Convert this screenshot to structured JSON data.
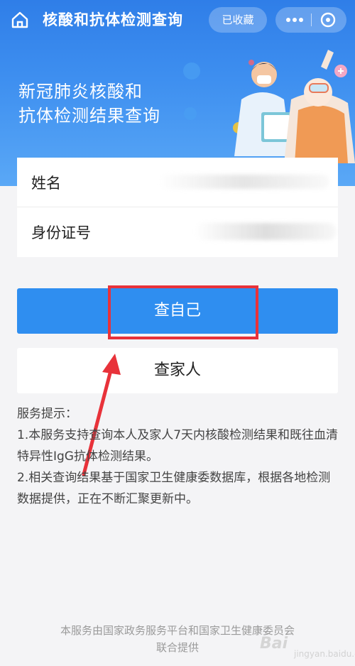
{
  "nav": {
    "title": "核酸和抗体检测查询",
    "collect_label": "已收藏",
    "icons": {
      "home": "home-icon",
      "more": "more-icon",
      "close": "close-circle-icon"
    }
  },
  "banner": {
    "title_line1": "新冠肺炎核酸和",
    "title_line2": "抗体检测结果查询",
    "illustration": "doctor-and-nurse-illustration"
  },
  "form": {
    "name_label": "姓名",
    "name_value": "",
    "id_label": "身份证号",
    "id_value": ""
  },
  "actions": {
    "self_label": "查自己",
    "family_label": "查家人"
  },
  "tips": {
    "heading": "服务提示：",
    "items": [
      "1.本服务支持查询本人及家人7天内核酸检测结果和既往血清特异性IgG抗体检测结果。",
      "2.相关查询结果基于国家卫生健康委数据库，根据各地检测数据提供，正在不断汇聚更新中。"
    ]
  },
  "footer": {
    "line1": "本服务由国家政务服务平台和国家卫生健康委员会",
    "line2": "联合提供"
  },
  "watermark": {
    "logo": "Bai",
    "text": "jingyan.baidu.com"
  },
  "colors": {
    "primary": "#2f8ef0",
    "banner": "#3f90f0",
    "highlight": "#e8323a"
  }
}
